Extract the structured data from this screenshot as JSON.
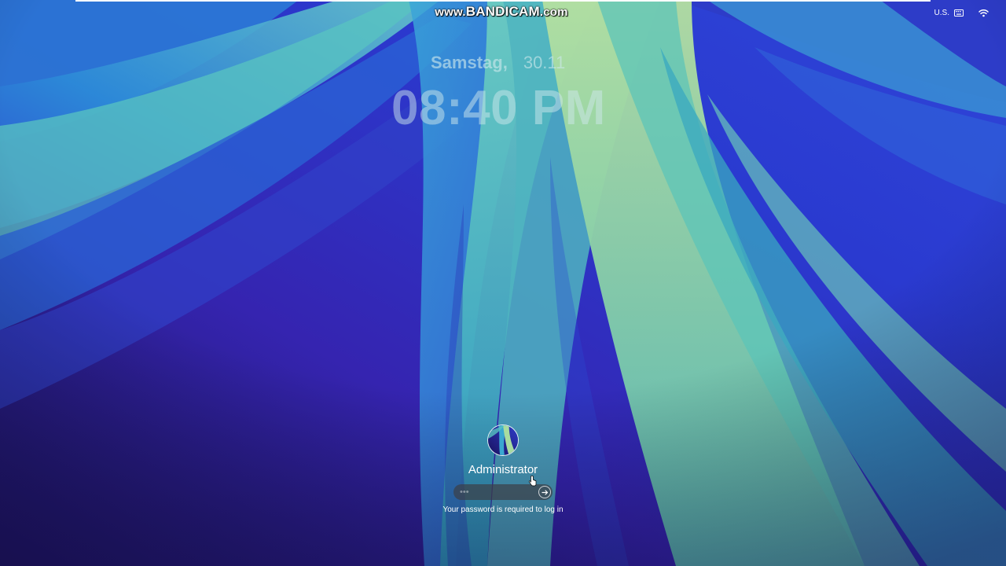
{
  "watermark": {
    "prefix": "www.",
    "brand": "BANDICAM",
    "suffix": ".com"
  },
  "status_bar": {
    "input_source": "U.S.",
    "keyboard_icon": "keyboard-icon",
    "wifi_icon": "wifi-icon"
  },
  "lock_screen": {
    "weekday": "Samstag,",
    "date": "30.11",
    "time": "08:40 PM"
  },
  "login": {
    "avatar_icon": "user-avatar",
    "username": "Administrator",
    "password_placeholder": "•••",
    "submit_icon": "arrow-right-circle-icon",
    "hint": "Your password is required to log in"
  },
  "colors": {
    "wallpaper_deep": "#1d1660",
    "wallpaper_blue": "#2a3ad0",
    "wallpaper_teal": "#3fb0b8",
    "wallpaper_mint": "#a8dca0"
  }
}
